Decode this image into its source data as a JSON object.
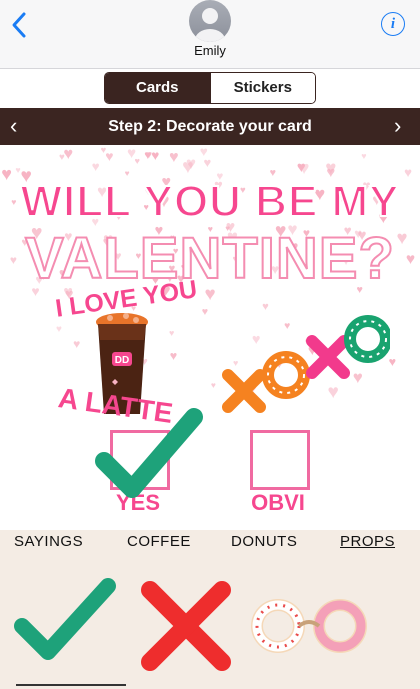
{
  "header": {
    "contact_name": "Emily",
    "info_glyph": "i"
  },
  "segmented": {
    "cards_label": "Cards",
    "stickers_label": "Stickers",
    "selected": "Cards"
  },
  "step": {
    "title": "Step 2: Decorate your card",
    "prev_glyph": "‹",
    "next_glyph": "›"
  },
  "card": {
    "line1": "WILL YOU BE MY",
    "line2": "VALENTINE?",
    "love_text": "I LOVE YOU",
    "latte_text": "A LATTE",
    "cup_logo": "DD",
    "option_yes": "YES",
    "option_obvi": "OBVI"
  },
  "categories": {
    "items": [
      "SAYINGS",
      "COFFEE",
      "DONUTS",
      "PROPS"
    ],
    "selected": "PROPS"
  },
  "colors": {
    "brand_brown": "#3b2521",
    "pink": "#f6478f",
    "green_check": "#1ea27a",
    "red_x": "#ee2d2d",
    "ios_blue": "#1a7cf4"
  }
}
